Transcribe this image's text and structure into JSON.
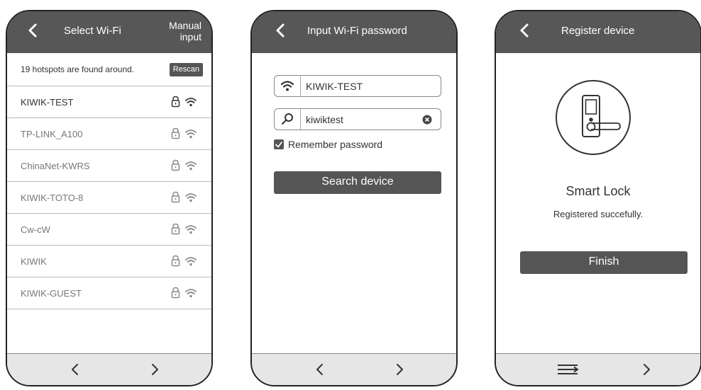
{
  "screen1": {
    "title": "Select Wi-Fi",
    "manual_input_line1": "Manual",
    "manual_input_line2": "input",
    "found_text": "19 hotspots are found around.",
    "rescan_label": "Rescan",
    "networks": [
      {
        "name": "KIWIK-TEST",
        "icons": [
          "lock-icon",
          "wifi-icon"
        ]
      },
      {
        "name": "TP-LINK_A100",
        "icons": [
          "lock-icon",
          "wifi-icon"
        ]
      },
      {
        "name": "ChinaNet-KWRS",
        "icons": [
          "lock-icon",
          "wifi-icon"
        ]
      },
      {
        "name": "KIWIK-TOTO-8",
        "icons": [
          "lock-icon",
          "wifi-icon"
        ]
      },
      {
        "name": "Cw-cW",
        "icons": [
          "lock-icon",
          "wifi-icon"
        ]
      },
      {
        "name": "KIWIK",
        "icons": [
          "lock-icon",
          "wifi-icon"
        ]
      },
      {
        "name": "KIWIK-GUEST",
        "icons": [
          "lock-icon",
          "wifi-icon"
        ]
      }
    ],
    "footer_icons": [
      "chevron-left-icon",
      "chevron-right-icon"
    ]
  },
  "screen2": {
    "title": "Input Wi-Fi password",
    "ssid_value": "KIWIK-TEST",
    "password_value": "kiwiktest",
    "remember_label": "Remember password",
    "remember_checked": true,
    "search_button_label": "Search device",
    "footer_icons": [
      "chevron-left-icon",
      "chevron-right-icon"
    ]
  },
  "screen3": {
    "title": "Register device",
    "device_name": "Smart Lock",
    "status_text": "Registered succefully.",
    "finish_button_label": "Finish",
    "footer_icons": [
      "menu-icon",
      "chevron-right-icon"
    ]
  },
  "colors": {
    "header_bg": "#575757",
    "button_bg": "#555555",
    "footer_bg": "#e6e6e6"
  }
}
